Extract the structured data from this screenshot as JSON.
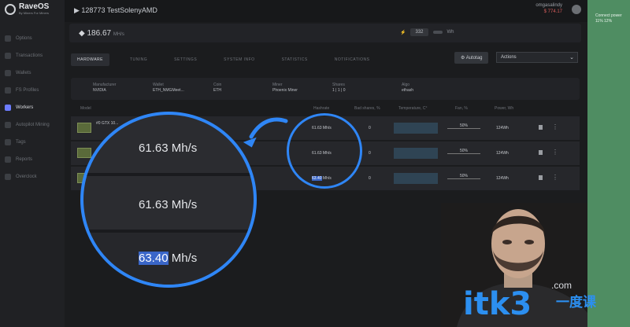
{
  "app": {
    "name": "RaveOS",
    "tagline": "By Miners For Miners"
  },
  "rig": {
    "title": "128773 TestSolenyAMD"
  },
  "user": {
    "name": "omgasalindy",
    "balance": "$ 774.17"
  },
  "sidebar": {
    "items": [
      {
        "label": "Options"
      },
      {
        "label": "Transactions"
      },
      {
        "label": "Wallets"
      },
      {
        "label": "FS Profiles"
      },
      {
        "label": "Workers",
        "active": true
      },
      {
        "label": "Autopilot Mining"
      },
      {
        "label": "Tags"
      },
      {
        "label": "Reports"
      },
      {
        "label": "Overclock"
      }
    ]
  },
  "stats": {
    "hashrate": "186.67",
    "hashrate_unit": "MH/s",
    "power_label": "332",
    "power_toggle": "",
    "power_unit": "Wh"
  },
  "tabs": [
    {
      "label": "HARDWARE",
      "active": true
    },
    {
      "label": "TUNING"
    },
    {
      "label": "SETTINGS"
    },
    {
      "label": "SYSTEM INFO"
    },
    {
      "label": "STATISTICS"
    },
    {
      "label": "NOTIFICATIONS"
    }
  ],
  "actions": {
    "button": "Autotag",
    "select_value": "Actions"
  },
  "info": {
    "manufacturer": {
      "label": "Manufacturer",
      "value": "NVIDIA"
    },
    "wallet": {
      "label": "Wallet",
      "value": "ETH_NMGMeet..."
    },
    "coin": {
      "label": "Coin",
      "value": "ETH"
    },
    "miner": {
      "label": "Miner",
      "value": "Phoenix Miner"
    },
    "shares": {
      "label": "Shares",
      "value": "1 | 1 | 0"
    },
    "algo": {
      "label": "Algo",
      "value": "ethash"
    }
  },
  "table": {
    "headers": {
      "model": "Model",
      "hashrate": "Hashrate",
      "bad_shares": "Bad shares, %",
      "temperature": "Temperature, C°",
      "fan": "Fan, %",
      "power": "Power, Wh"
    },
    "rows": [
      {
        "model": "#0 GTX 10...",
        "hashrate": "61.63 Mh/s",
        "bad_shares": "0",
        "fan": "50%",
        "power": "124Wh"
      },
      {
        "model": "",
        "hashrate": "61.63 Mh/s",
        "bad_shares": "0",
        "fan": "50%",
        "power": "124Wh"
      },
      {
        "model": "",
        "hashrate": "63.40 Mh/s",
        "hashrate_num": "63.40",
        "hashrate_unit": " Mh/s",
        "bad_shares": "0",
        "fan": "50%",
        "power": "124Wh"
      }
    ]
  },
  "zoom": {
    "rows": [
      {
        "value": "61.63 Mh/s"
      },
      {
        "value": "61.63 Mh/s"
      },
      {
        "num": "63.40",
        "unit": " Mh/s"
      }
    ]
  },
  "side_note": {
    "text": "Connect power 11% 12%"
  },
  "watermark": {
    "text": "itk3",
    "suffix": "一度课",
    "dotcom": ".com"
  },
  "colors": {
    "accent": "#2f86f6",
    "highlight": "#3a66c8",
    "green_panel": "#4f8d62"
  }
}
